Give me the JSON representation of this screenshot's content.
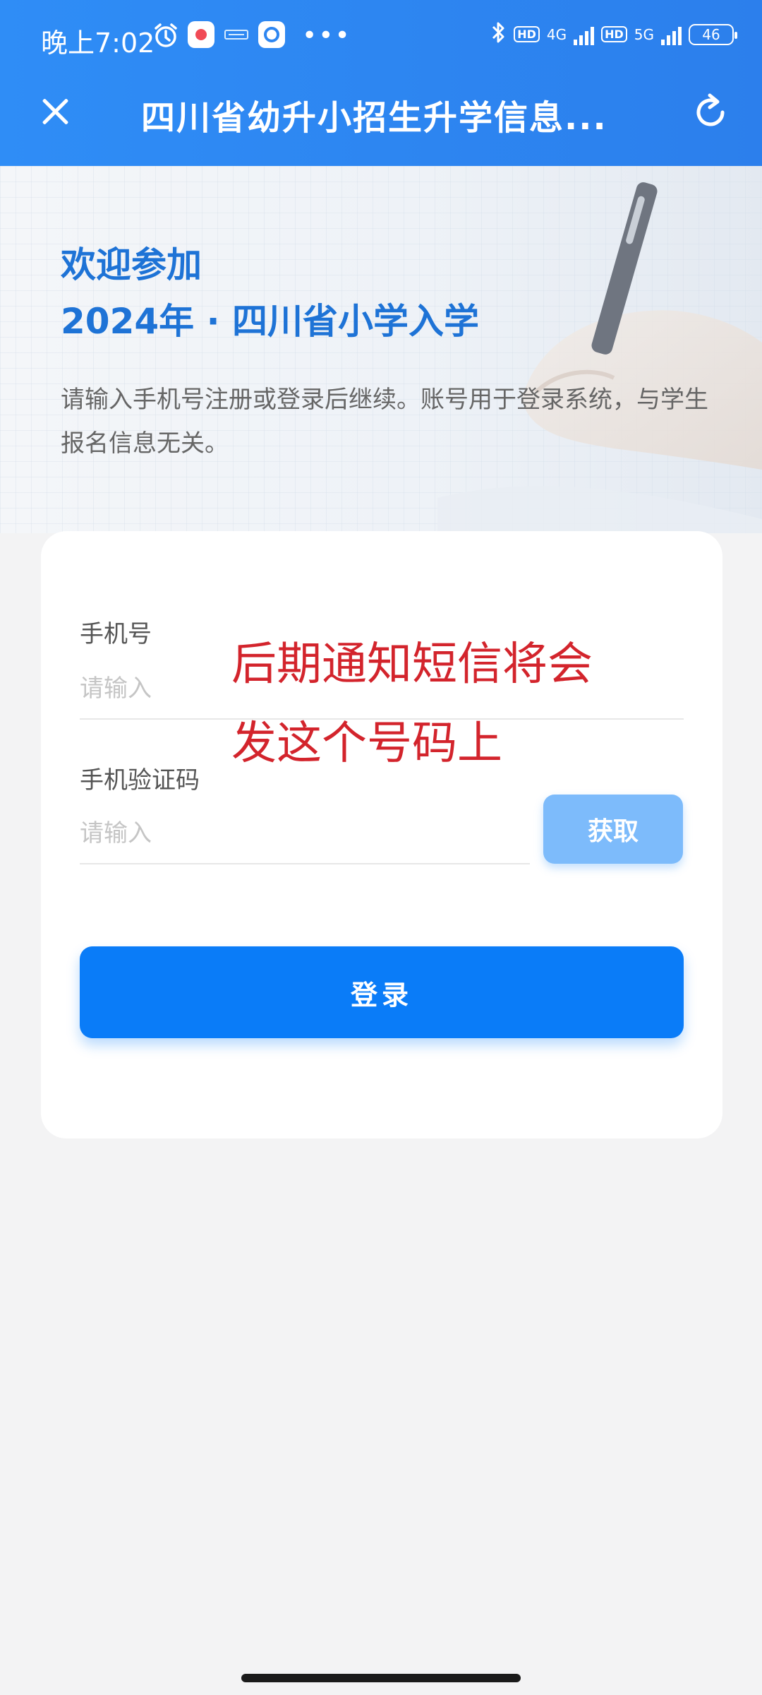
{
  "status_bar": {
    "time": "晚上7:02",
    "network_1": "4G",
    "network_2": "5G",
    "hd_label": "HD",
    "battery": "46"
  },
  "app_bar": {
    "title": "四川省幼升小招生升学信息..."
  },
  "hero": {
    "welcome_line1": "欢迎参加",
    "welcome_line2": "2024年 · 四川省小学入学",
    "hint": "请输入手机号注册或登录后继续。账号用于登录系统，与学生报名信息无关。"
  },
  "form": {
    "phone_label": "手机号",
    "phone_placeholder": "请输入",
    "code_label": "手机验证码",
    "code_placeholder": "请输入",
    "get_code_label": "获取",
    "login_label": "登录"
  },
  "annotation": {
    "line1": "后期通知短信将会",
    "line2": "发这个号码上"
  },
  "colors": {
    "brand_blue": "#0a7cf8",
    "header_blue": "#2d86f1",
    "annotation_red": "#d3242c"
  }
}
